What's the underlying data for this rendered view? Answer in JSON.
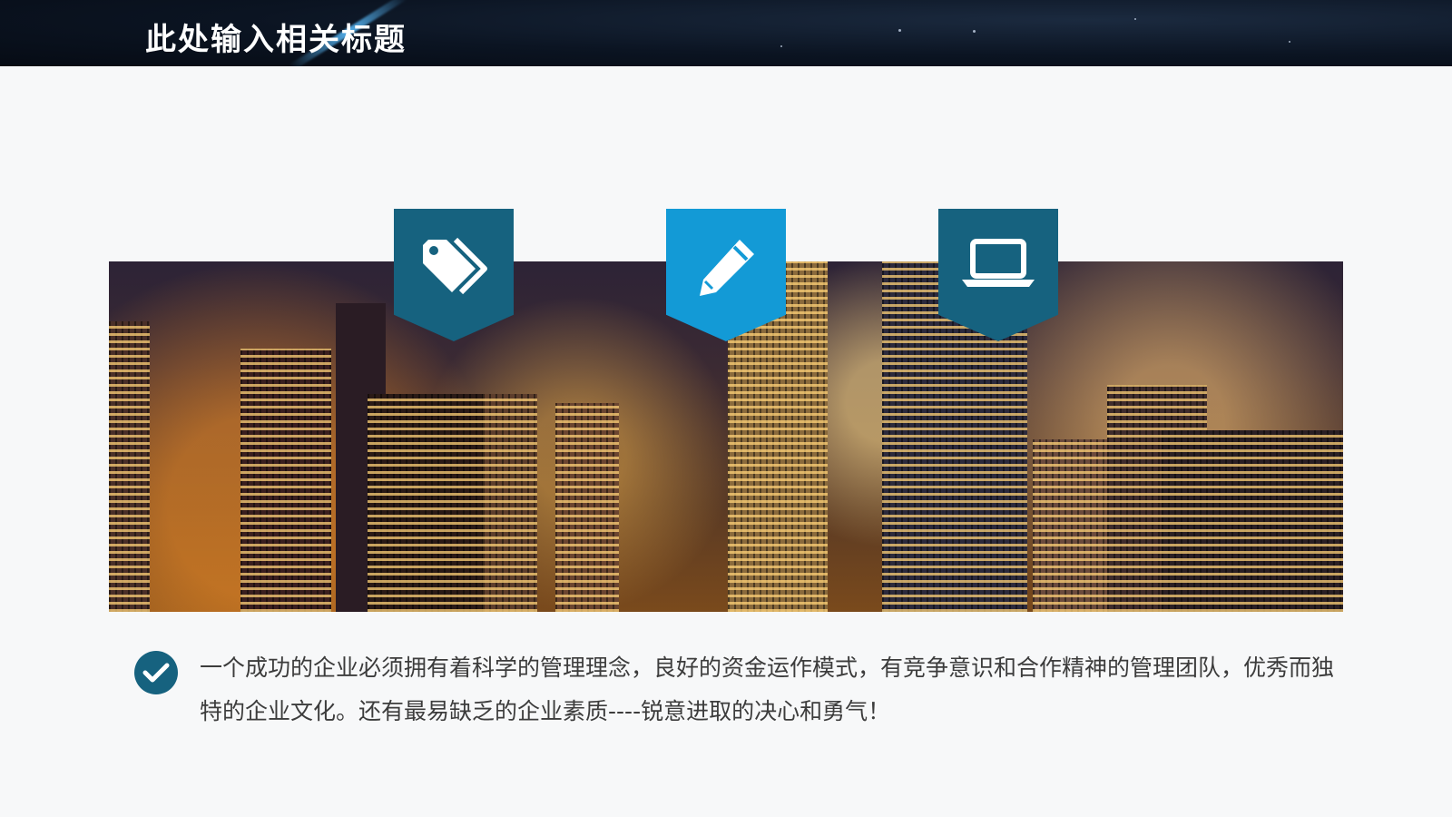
{
  "header": {
    "title": "此处输入相关标题"
  },
  "features": [
    {
      "icon": "tag-icon",
      "color": "#16627f"
    },
    {
      "icon": "pencil-icon",
      "color": "#139ad6"
    },
    {
      "icon": "laptop-icon",
      "color": "#16627f"
    }
  ],
  "banner": {
    "image": "city-night-skyline"
  },
  "content": {
    "bullet_icon": "checkmark-icon",
    "text": "一个成功的企业必须拥有着科学的管理理念，良好的资金运作模式，有竞争意识和合作精神的管理团队，优秀而独特的企业文化。还有最易缺乏的企业素质----锐意进取的决心和勇气！"
  },
  "colors": {
    "primary": "#16627f",
    "accent": "#139ad6",
    "header_bg": "#0b1422"
  }
}
